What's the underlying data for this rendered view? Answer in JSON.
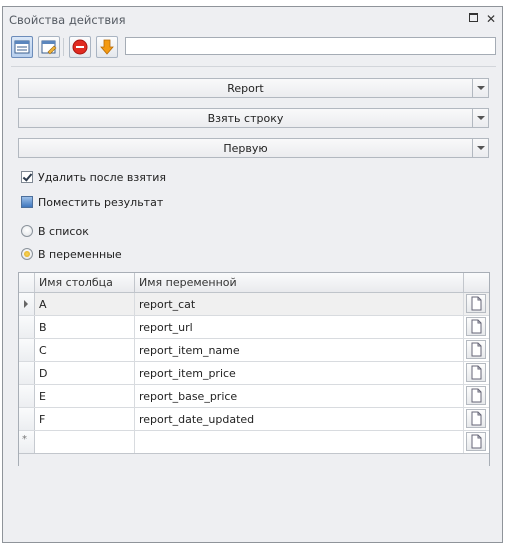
{
  "window": {
    "title": "Свойства действия",
    "restore_icon": "restore-icon",
    "close_icon": "close-icon",
    "close_glyph": "✕"
  },
  "toolbar": {
    "buttons": [
      {
        "name": "table-view-icon",
        "active": true
      },
      {
        "name": "window-edit-icon",
        "active": false
      },
      {
        "name": "stop-icon",
        "active": false
      },
      {
        "name": "arrow-down-icon",
        "active": false
      }
    ],
    "input_value": ""
  },
  "combos": {
    "source": "Report",
    "action": "Взять строку",
    "which": "Первую"
  },
  "options": {
    "delete_after_take": {
      "label": "Удалить после взятия",
      "checked": true
    },
    "store_result": {
      "label": "Поместить результат",
      "checked": false
    }
  },
  "radios": {
    "to_list": {
      "label": "В список",
      "checked": false
    },
    "to_variables": {
      "label": "В переменные",
      "checked": true
    }
  },
  "grid": {
    "headers": [
      "Имя столбца",
      "Имя переменной"
    ],
    "rows": [
      {
        "column": "A",
        "variable": "report_cat"
      },
      {
        "column": "B",
        "variable": "report_url"
      },
      {
        "column": "C",
        "variable": "report_item_name"
      },
      {
        "column": "D",
        "variable": "report_item_price"
      },
      {
        "column": "E",
        "variable": "report_base_price"
      },
      {
        "column": "F",
        "variable": "report_date_updated"
      }
    ],
    "new_row_marker": "*"
  },
  "colors": {
    "accent_blue": "#3f76bd",
    "radio_selected": "#e0a91c",
    "stop_red": "#e02a20",
    "arrow_orange": "#f39a12"
  }
}
